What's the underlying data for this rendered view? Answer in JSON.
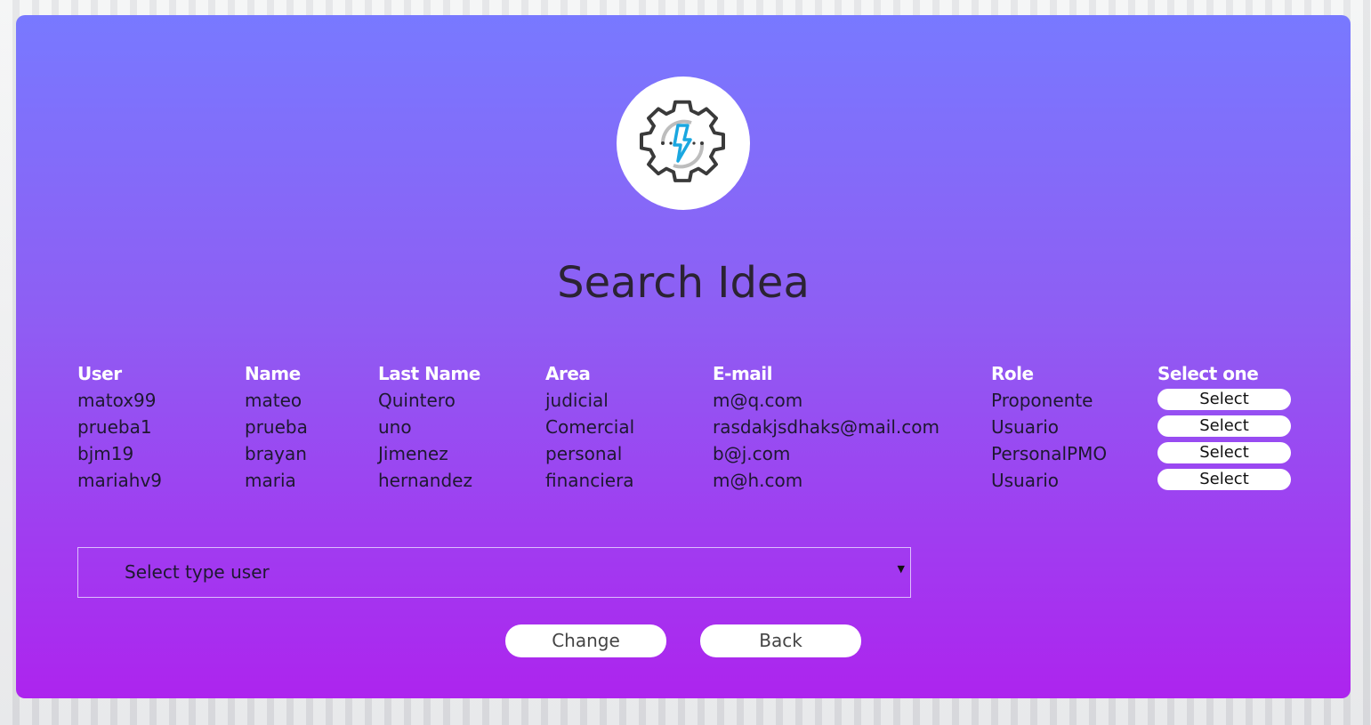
{
  "page": {
    "title": "Search Idea",
    "logo_icon": "gear-lightning-icon",
    "accent_top": "#7879ff",
    "accent_bottom": "#ad24ee"
  },
  "table": {
    "headers": {
      "user": "User",
      "name": "Name",
      "last_name": "Last Name",
      "area": "Area",
      "email": "E-mail",
      "role": "Role",
      "select_one": "Select one"
    },
    "rows": [
      {
        "user": "matox99",
        "name": "mateo",
        "last_name": "Quintero",
        "area": "judicial",
        "email": "m@q.com",
        "role": "Proponente",
        "select_label": "Select"
      },
      {
        "user": "prueba1",
        "name": "prueba",
        "last_name": "uno",
        "area": "Comercial",
        "email": "rasdakjsdhaks@mail.com",
        "role": "Usuario",
        "select_label": "Select"
      },
      {
        "user": "bjm19",
        "name": "brayan",
        "last_name": "Jimenez",
        "area": "personal",
        "email": "b@j.com",
        "role": "PersonalPMO",
        "select_label": "Select"
      },
      {
        "user": "mariahv9",
        "name": "maria",
        "last_name": "hernandez",
        "area": "financiera",
        "email": "m@h.com",
        "role": "Usuario",
        "select_label": "Select"
      }
    ]
  },
  "type_select": {
    "value": "Select type user",
    "arrow_icon": "caret-down-icon"
  },
  "actions": {
    "change_label": "Change",
    "back_label": "Back"
  }
}
